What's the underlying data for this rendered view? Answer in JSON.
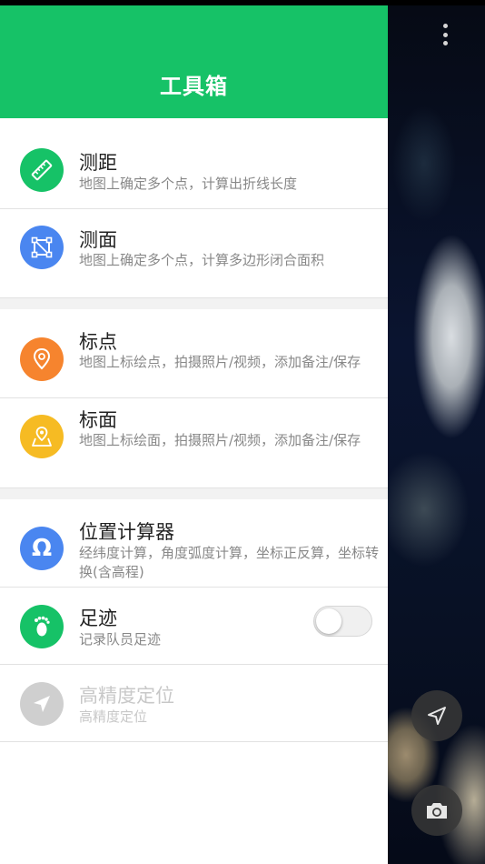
{
  "header": {
    "title": "工具箱"
  },
  "items": [
    {
      "title": "测距",
      "desc": "地图上确定多个点，计算出折线长度",
      "icon": "ruler-icon",
      "color": "#16c267"
    },
    {
      "title": "测面",
      "desc": "地图上确定多个点，计算多边形闭合面积",
      "icon": "area-polygon-icon",
      "color": "#4a86f0"
    },
    {
      "title": "标点",
      "desc": "地图上标绘点，拍摄照片/视频，添加备注/保存",
      "icon": "location-pin-icon",
      "color": "#f6842e"
    },
    {
      "title": "标面",
      "desc": "地图上标绘面，拍摄照片/视频，添加备注/保存",
      "icon": "area-pin-icon",
      "color": "#f6bb23"
    },
    {
      "title": "位置计算器",
      "desc": "经纬度计算，角度弧度计算，坐标正反算，坐标转换(含高程)",
      "icon": "omega-icon",
      "color": "#4a86f0"
    },
    {
      "title": "足迹",
      "desc": "记录队员足迹",
      "icon": "footprint-icon",
      "color": "#16c267",
      "toggle": "off"
    },
    {
      "title": "高精度定位",
      "desc": "高精度定位",
      "icon": "navigation-arrow-icon",
      "color": "#cfcfcf",
      "state": "disabled"
    }
  ],
  "map_controls": [
    "more-vertical-icon",
    "navigation-arrow-icon",
    "camera-icon"
  ]
}
